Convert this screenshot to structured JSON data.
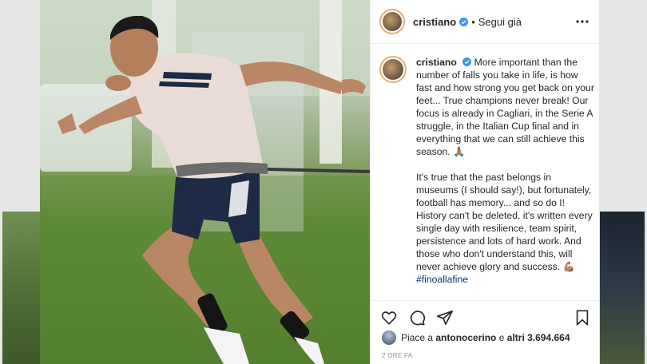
{
  "post": {
    "username": "cristiano",
    "separator": "•",
    "follow_label": "Segui già",
    "more_icon": "more-options-icon",
    "caption_user": "cristiano",
    "caption_p1": "More important than the number of falls you take in life, is how fast and how strong you get back on your feet... True champions never break! Our focus is already in Cagliari, in the Serie A struggle, in the Italian Cup final and in everything that we can still achieve this season.",
    "caption_p1_emoji": "🙏🏽",
    "caption_p2": "It's true that the past belongs in museums (I should say!), but fortunately, football has memory... and so do I! History can't be deleted, it's written every single day with resilience, team spirit, persistence and lots of hard work. And those who don't understand this, will never achieve glory and success.",
    "caption_p2_emoji": "💪🏽",
    "hashtag": "#finoallafine",
    "likes_prefix": "Piace a",
    "likes_user": "antonocerino",
    "likes_mid": "e",
    "likes_count": "altri 3.694.664",
    "timestamp": "2 ORE FA"
  },
  "icons": {
    "like": "heart-icon",
    "comment": "comment-icon",
    "share": "share-icon",
    "save": "bookmark-icon",
    "verified": "verified-badge-icon"
  },
  "colors": {
    "verified": "#3897f0",
    "hashtag": "#00376b",
    "text": "#262626",
    "muted": "#8e8e8e"
  }
}
